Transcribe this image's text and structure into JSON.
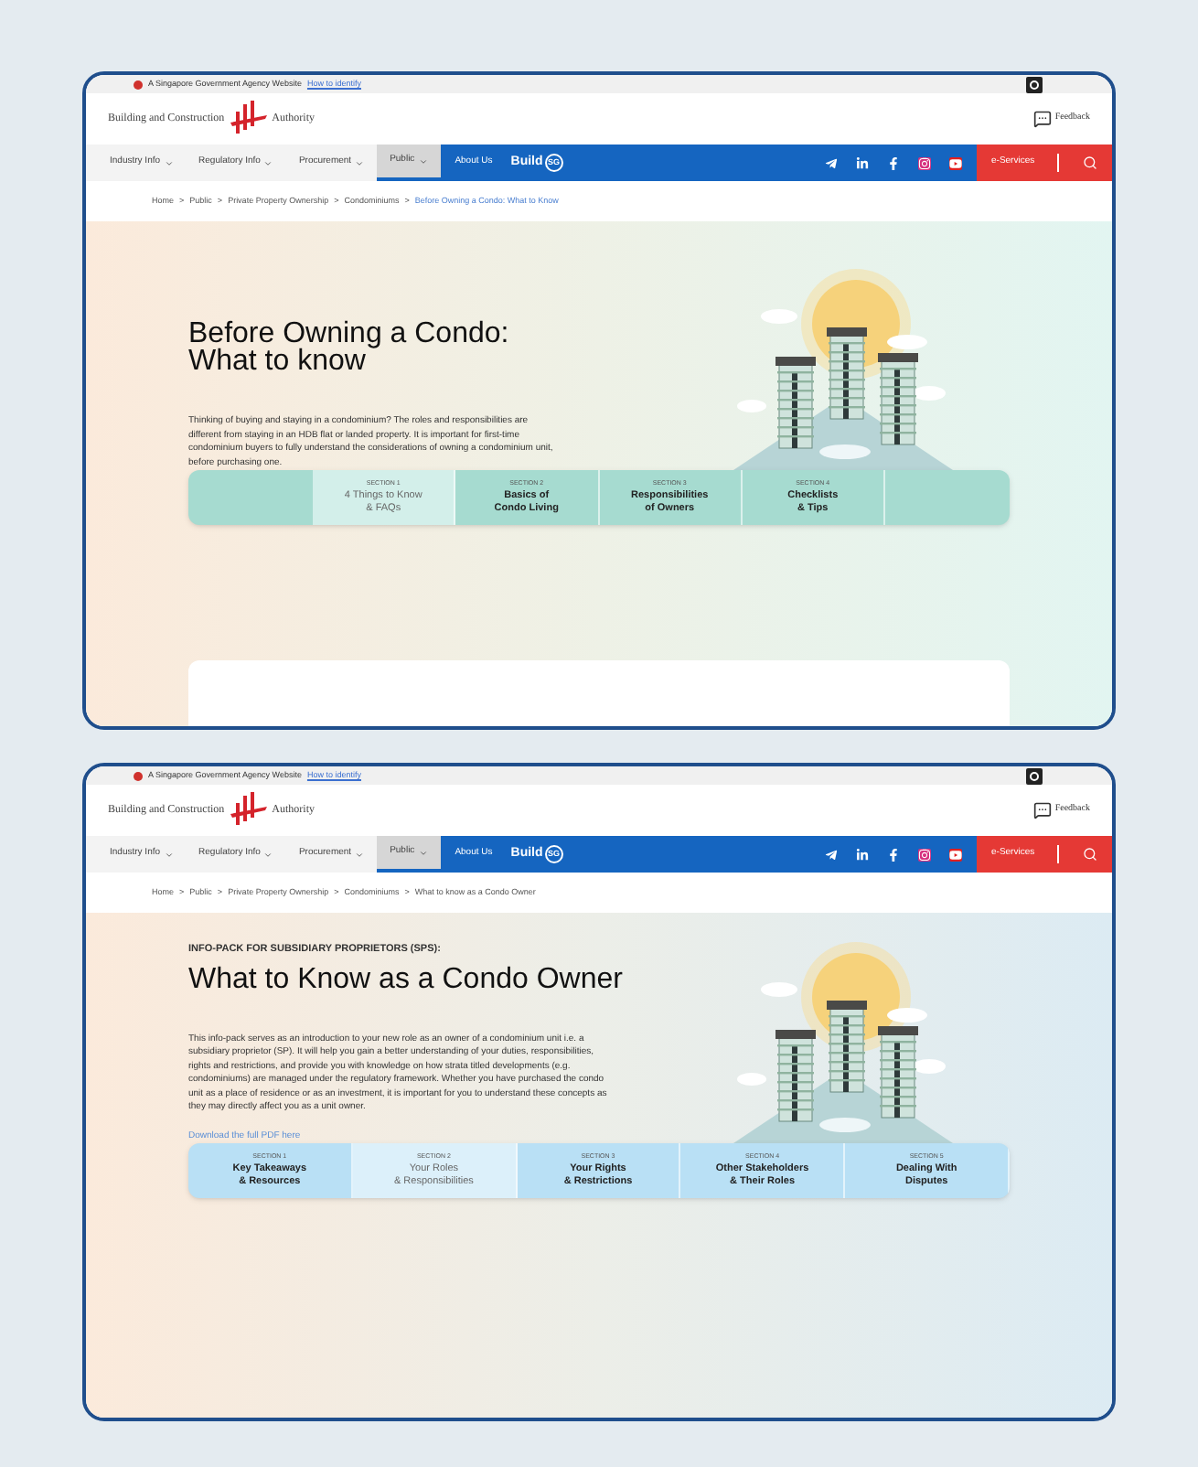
{
  "screenshots": [
    {
      "gov_banner": {
        "text": "A Singapore Government Agency Website",
        "link": "How to identify"
      },
      "logo": {
        "left": "Building and Construction",
        "right": "Authority"
      },
      "feedback": "Feedback",
      "nav": [
        {
          "label": "Industry Info",
          "selected": false
        },
        {
          "label": "Regulatory Info",
          "selected": false
        },
        {
          "label": "Procurement",
          "selected": false
        },
        {
          "label": "Public",
          "selected": true
        }
      ],
      "about": "About Us",
      "build_logo": {
        "left": "Build",
        "right": "SG"
      },
      "eservices": "e-Services",
      "breadcrumb_separator": ">",
      "breadcrumb": [
        {
          "label": "Home",
          "current": false
        },
        {
          "label": "Public",
          "current": false
        },
        {
          "label": "Private Property Ownership",
          "current": false
        },
        {
          "label": "Condominiums",
          "current": false
        },
        {
          "label": "Before Owning a Condo: What to Know",
          "current": true
        }
      ],
      "title": "Before Owning a Condo: What to know",
      "paragraph": "Thinking of buying and staying in a condominium? The roles and responsibilities are different from staying in an HDB flat or landed property. It is important for first-time condominium buyers to fully understand the considerations of owning a condominium unit, before purchasing one.",
      "tab_bar": {
        "kind": "teal",
        "padded": true
      },
      "tabs": [
        {
          "section": "SECTION 1",
          "label": "4 Things to Know\n& FAQs",
          "selected": true
        },
        {
          "section": "SECTION 2",
          "label": "Basics of\nCondo Living",
          "selected": false
        },
        {
          "section": "SECTION 3",
          "label": "Responsibilities\nof Owners",
          "selected": false
        },
        {
          "section": "SECTION 4",
          "label": "Checklists\n& Tips",
          "selected": false
        }
      ],
      "card": true
    },
    {
      "gov_banner": {
        "text": "A Singapore Government Agency Website",
        "link": "How to identify"
      },
      "logo": {
        "left": "Building and Construction",
        "right": "Authority"
      },
      "feedback": "Feedback",
      "nav": [
        {
          "label": "Industry Info",
          "selected": false
        },
        {
          "label": "Regulatory Info",
          "selected": false
        },
        {
          "label": "Procurement",
          "selected": false
        },
        {
          "label": "Public",
          "selected": true
        }
      ],
      "about": "About Us",
      "build_logo": {
        "left": "Build",
        "right": "SG"
      },
      "eservices": "e-Services",
      "breadcrumb_separator": ">",
      "breadcrumb": [
        {
          "label": "Home",
          "current": false
        },
        {
          "label": "Public",
          "current": false
        },
        {
          "label": "Private Property Ownership",
          "current": false
        },
        {
          "label": "Condominiums",
          "current": false
        },
        {
          "label": "What to know as a Condo Owner",
          "current": false
        }
      ],
      "kicker": "INFO-PACK FOR SUBSIDIARY PROPRIETORS (SPS):",
      "title": "What to Know as a Condo Owner",
      "paragraph": "This info-pack serves as an introduction to your new role as an owner of a condominium unit i.e. a subsidiary proprietor (SP). It will help you gain a better understanding of your duties, responsibilities, rights and restrictions, and provide you with knowledge on how strata titled developments (e.g. condominiums) are managed under the regulatory framework. Whether you have purchased the condo unit as a place of residence or as an investment, it is important for you to understand these concepts as they may directly affect you as a unit owner.",
      "download_link": "Download the full PDF here",
      "tab_bar": {
        "kind": "blue",
        "padded": false
      },
      "tabs": [
        {
          "section": "SECTION 1",
          "label": "Key Takeaways\n& Resources",
          "selected": false
        },
        {
          "section": "SECTION 2",
          "label": "Your Roles\n& Responsibilities",
          "selected": true
        },
        {
          "section": "SECTION 3",
          "label": "Your Rights\n& Restrictions",
          "selected": false
        },
        {
          "section": "SECTION 4",
          "label": "Other Stakeholders\n& Their Roles",
          "selected": false
        },
        {
          "section": "SECTION 5",
          "label": "Dealing With\nDisputes",
          "selected": false
        }
      ],
      "card": false
    }
  ]
}
